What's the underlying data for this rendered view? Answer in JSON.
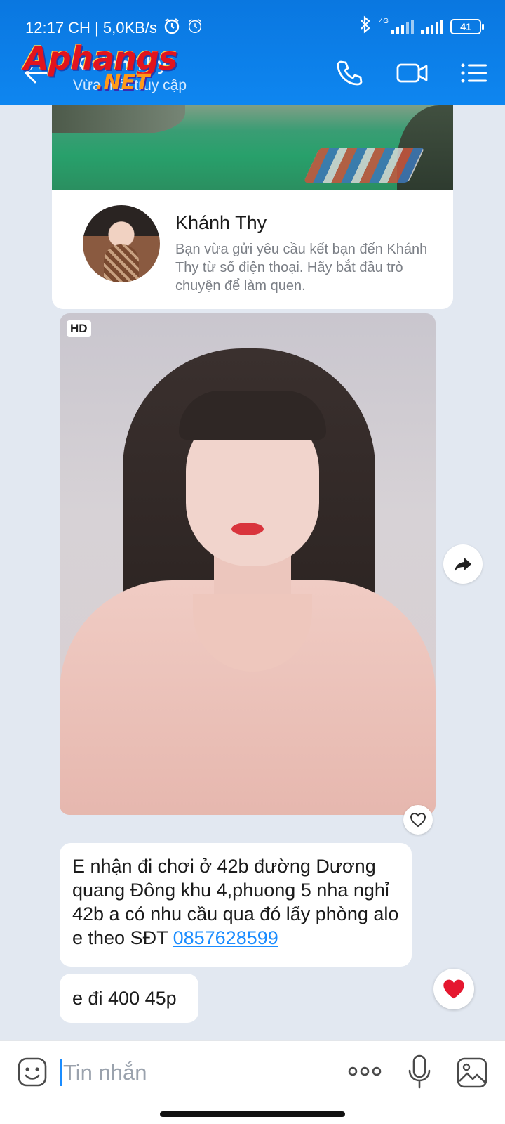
{
  "status_bar": {
    "time_speed": "12:17 CH | 5,0KB/s",
    "network": "4G",
    "battery": "41"
  },
  "header": {
    "contact_name": "Khánh Thy",
    "status": "Vừa mới truy cập",
    "watermark_main": "Aphangs",
    "watermark_sub": ".NET",
    "bg_color": "#0e86f0"
  },
  "profile_card": {
    "name": "Khánh Thy",
    "description": "Bạn vừa gửi yêu cầu kết bạn đến Khánh Thy từ số điện thoại. Hãy bắt đầu trò chuyện để làm quen."
  },
  "photo_message": {
    "badge": "HD"
  },
  "messages": [
    {
      "text": "E nhận đi chơi ở 42b  đường Dương quang Đông  khu  4,phuong 5 nha nghỉ 42b a có nhu cầu qua đó lấy phòng alo e theo SĐT ",
      "phone_link": "0857628599"
    },
    {
      "text": "e đi 400 45p"
    }
  ],
  "composer": {
    "placeholder": "Tin nhắn"
  },
  "colors": {
    "link": "#1a8cff",
    "reaction_heart": "#e5172f",
    "chat_background": "#e2e8f1"
  }
}
